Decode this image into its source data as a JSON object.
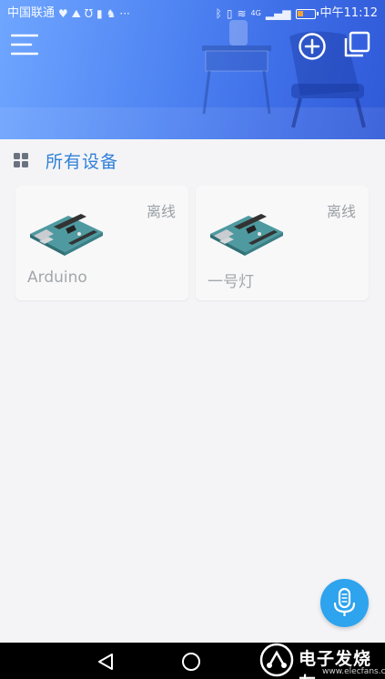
{
  "status_bar": {
    "carrier": "中国联通",
    "left_icons": [
      "heart-rate-icon",
      "chart-icon",
      "vibrate-icon",
      "notification-icon",
      "app-icon",
      "more-dots-icon"
    ],
    "network": "4G",
    "battery_level": "11",
    "time": "中午11:12"
  },
  "header": {
    "menu_icon": "hamburger-menu-icon",
    "add_icon": "plus-circle-icon",
    "copy_icon": "copy-icon"
  },
  "section": {
    "title": "所有设备",
    "icon": "grid-icon"
  },
  "devices": [
    {
      "name": "Arduino",
      "status": "离线",
      "icon": "arduino-board-icon"
    },
    {
      "name": "一号灯",
      "status": "离线",
      "icon": "arduino-board-icon"
    }
  ],
  "fab": {
    "icon": "microphone-icon"
  },
  "navigation": {
    "back_icon": "back-triangle-icon",
    "home_icon": "home-circle-icon"
  },
  "watermark": {
    "title": "电子发烧友",
    "url": "www.elecfans.com"
  },
  "colors": {
    "accent": "#2f80d8",
    "fab": "#2ea3ee",
    "header_gradient_start": "#6fa6ff",
    "header_gradient_end": "#2f59d8",
    "status_offline": "#9aa0a6"
  }
}
